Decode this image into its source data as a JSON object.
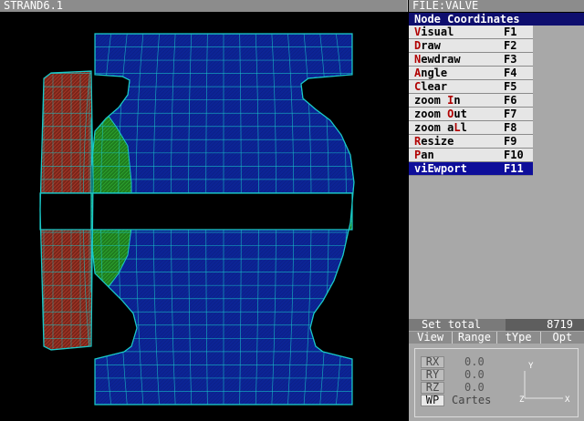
{
  "app": {
    "title": "STRAND6.1",
    "file": "FILE:VALVE"
  },
  "menu": {
    "header": "Node Coordinates",
    "items": [
      {
        "hotkey": "V",
        "rest": "isual",
        "key": "F1"
      },
      {
        "hotkey": "D",
        "rest": "raw",
        "key": "F2"
      },
      {
        "hotkey": "N",
        "rest": "ewdraw",
        "key": "F3"
      },
      {
        "hotkey": "A",
        "rest": "ngle",
        "key": "F4"
      },
      {
        "hotkey": "C",
        "rest": "lear",
        "key": "F5"
      },
      {
        "pre": "zoom ",
        "hotkey": "I",
        "rest": "n",
        "key": "F6"
      },
      {
        "pre": "zoom ",
        "hotkey": "O",
        "rest": "ut",
        "key": "F7"
      },
      {
        "pre": "zoom a",
        "hotkey": "L",
        "rest": "l",
        "key": "F8"
      },
      {
        "hotkey": "R",
        "rest": "esize",
        "key": "F9"
      },
      {
        "hotkey": "P",
        "rest": "an",
        "key": "F10"
      },
      {
        "pre": "viEwport",
        "key": "F11",
        "selected": true
      }
    ]
  },
  "set_total": {
    "label": "Set total",
    "value": "8719"
  },
  "tabs": [
    "View",
    "Range",
    "tYpe",
    "Opt"
  ],
  "rotation": [
    {
      "key": "RX",
      "value": "0.0"
    },
    {
      "key": "RY",
      "value": "0.0"
    },
    {
      "key": "RZ",
      "value": "0.0"
    }
  ],
  "wp": {
    "key": "WP",
    "value": "Cartes"
  },
  "axes": {
    "y": "Y",
    "z": "Z",
    "x": "X"
  },
  "colors": {
    "mesh_line": "#19c8c8",
    "body_fill": "#0c2496",
    "pipe_fill": "#7a2418",
    "band_fill": "#1e7a1e",
    "background": "#000000",
    "selected": "#0e0e9a"
  }
}
